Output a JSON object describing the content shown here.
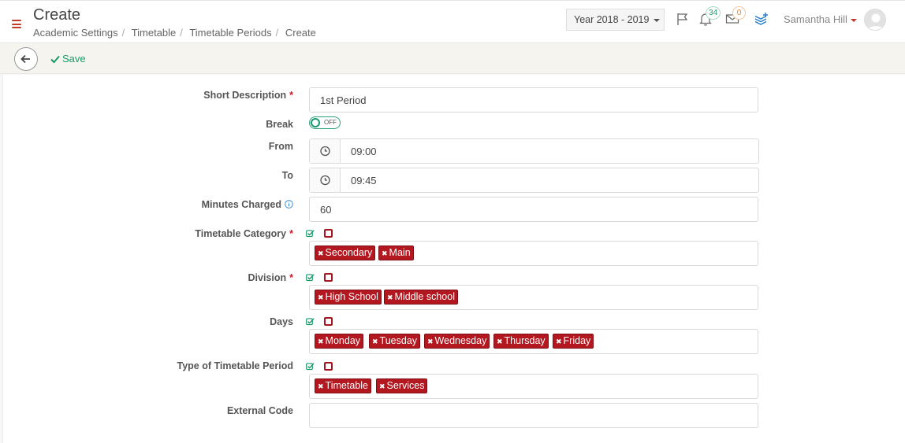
{
  "header": {
    "title": "Create",
    "breadcrumb": [
      "Academic Settings",
      "Timetable",
      "Timetable Periods",
      "Create"
    ],
    "year_select": "Year 2018 - 2019",
    "notifications_count": "34",
    "messages_count": "0",
    "user_name": "Samantha Hill"
  },
  "toolbar": {
    "save_label": "Save"
  },
  "form": {
    "short_description": {
      "label": "Short Description",
      "value": "1st Period"
    },
    "break": {
      "label": "Break",
      "toggle_text": "OFF"
    },
    "from": {
      "label": "From",
      "value": "09:00"
    },
    "to": {
      "label": "To",
      "value": "09:45"
    },
    "minutes_charged": {
      "label": "Minutes Charged",
      "value": "60"
    },
    "timetable_category": {
      "label": "Timetable Category",
      "tags": [
        "Secondary",
        "Main"
      ]
    },
    "division": {
      "label": "Division",
      "tags": [
        "High School",
        "Middle school"
      ]
    },
    "days": {
      "label": "Days",
      "tags": [
        "Monday",
        "Tuesday",
        "Wednesday",
        "Thursday",
        "Friday"
      ]
    },
    "type_of_period": {
      "label": "Type of Timetable Period",
      "tags": [
        "Timetable",
        "Services"
      ]
    },
    "external_code": {
      "label": "External Code",
      "value": ""
    }
  },
  "colors": {
    "accent_green": "#1a9a6a",
    "tag_red": "#b3171f",
    "required_red": "#d0152c"
  },
  "icons": [
    "menu-icon",
    "flag-icon",
    "bell-icon",
    "envelope-icon",
    "layers-plus-icon",
    "back-arrow-icon",
    "check-icon",
    "clock-icon",
    "info-icon",
    "check-all-icon",
    "uncheck-all-icon",
    "remove-tag-icon"
  ]
}
